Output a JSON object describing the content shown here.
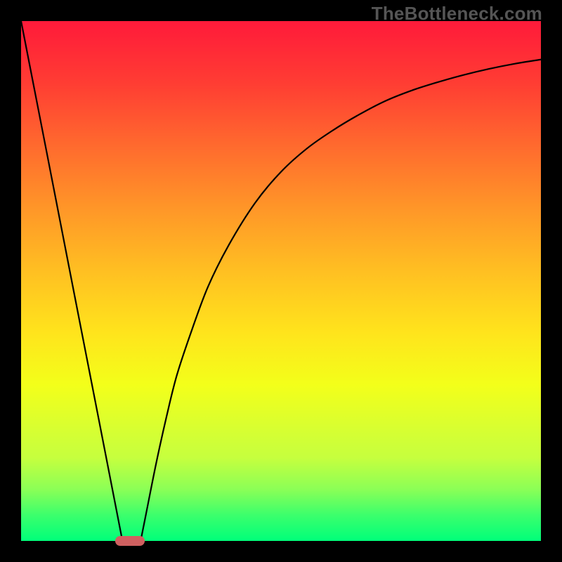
{
  "watermark": "TheBottleneck.com",
  "colors": {
    "background": "#000000",
    "gradient_top": "#ff1a3a",
    "gradient_bottom": "#00ff7a",
    "curve": "#000000",
    "marker": "#cf6060",
    "watermark": "#555555"
  },
  "chart_data": {
    "type": "line",
    "title": "",
    "xlabel": "",
    "ylabel": "",
    "xlim": [
      0,
      100
    ],
    "ylim": [
      0,
      100
    ],
    "grid": false,
    "series": [
      {
        "name": "left-descent",
        "x": [
          0,
          5,
          10,
          15,
          18,
          19.5
        ],
        "values": [
          100,
          74.4,
          48.7,
          23.1,
          7.7,
          0
        ]
      },
      {
        "name": "right-curve",
        "x": [
          23,
          24,
          26,
          28,
          30,
          33,
          36,
          40,
          45,
          50,
          55,
          60,
          65,
          70,
          75,
          80,
          85,
          90,
          95,
          100
        ],
        "values": [
          0,
          5,
          15,
          24,
          32,
          41,
          49,
          57,
          65,
          71,
          75.5,
          79,
          82,
          84.6,
          86.6,
          88.2,
          89.6,
          90.8,
          91.8,
          92.6
        ]
      }
    ],
    "marker": {
      "x": 21,
      "y": 0,
      "shape": "pill"
    },
    "notes": "Values are approximate, read off the image proportionally since no axis ticks are rendered."
  }
}
